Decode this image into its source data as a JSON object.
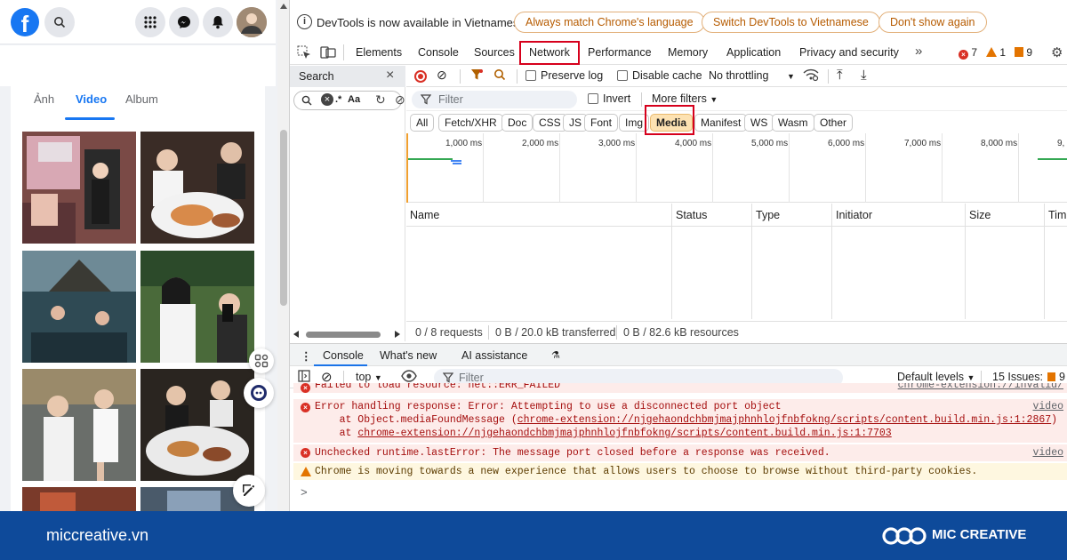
{
  "facebook": {
    "logo_letter": "f",
    "tabs": [
      "Ảnh",
      "Video",
      "Album"
    ],
    "active_tab": "Video",
    "colors": {
      "brand": "#1877f2"
    }
  },
  "devtools": {
    "infobar": {
      "message": "DevTools is now available in Vietnamese!",
      "buttons": [
        "Always match Chrome's language",
        "Switch DevTools to Vietnamese",
        "Don't show again"
      ]
    },
    "tabs": [
      "Elements",
      "Console",
      "Sources",
      "Network",
      "Performance",
      "Memory",
      "Application",
      "Privacy and security"
    ],
    "active_tab": "Network",
    "counts": {
      "errors": "7",
      "warnings": "1",
      "issues": "9"
    },
    "sidebar": {
      "title": "Search",
      "search_opts": ".*",
      "search_case": "Aa"
    },
    "network_toolbar": {
      "preserve_log": "Preserve log",
      "disable_cache": "Disable cache",
      "throttling": "No throttling"
    },
    "filter": {
      "placeholder": "Filter",
      "invert": "Invert",
      "more_filters": "More filters"
    },
    "type_filters": [
      "All",
      "Fetch/XHR",
      "Doc",
      "CSS",
      "JS",
      "Font",
      "Img",
      "Media",
      "Manifest",
      "WS",
      "Wasm",
      "Other"
    ],
    "active_type": "Media",
    "timeline_labels": [
      "1,000 ms",
      "2,000 ms",
      "3,000 ms",
      "4,000 ms",
      "5,000 ms",
      "6,000 ms",
      "7,000 ms",
      "8,000 ms",
      "9,"
    ],
    "columns": [
      "Name",
      "Status",
      "Type",
      "Initiator",
      "Size",
      "Tim"
    ],
    "status_bar": {
      "requests": "0 / 8 requests",
      "transferred": "0 B / 20.0 kB transferred",
      "resources": "0 B / 82.6 kB resources"
    },
    "drawer_tabs": [
      "Console",
      "What's new",
      "AI assistance"
    ],
    "console_toolbar": {
      "context": "top",
      "filter_placeholder": "Filter",
      "levels": "Default levels",
      "issues_label": "15 Issues:",
      "issues_count": "9"
    },
    "console_messages": {
      "partial_top": "Failed to load resource: net::ERR_FAILED",
      "partial_top_src": "chrome-extension://invalid/",
      "err1_line1": "Error handling response: Error: Attempting to use a disconnected port object",
      "err1_line2_prefix": "    at Object.mediaFoundMessage (",
      "err1_line2_link": "chrome-extension://njgehaondchbmjmajphnhlojfnbfokng/scripts/content.build.min.js:1:2867",
      "err1_line2_suffix": ")",
      "err1_line3_prefix": "    at ",
      "err1_line3_link": "chrome-extension://njgehaondchbmjmajphnhlojfnbfokng/scripts/content.build.min.js:1:7703",
      "err1_src": "video",
      "err2": "Unchecked runtime.lastError: The message port closed before a response was received.",
      "err2_src": "video",
      "warn1": "Chrome is moving towards a new experience that allows users to choose to browse without third-party cookies.",
      "prompt": ">"
    },
    "colors": {
      "highlight_box": "#d6001c",
      "media_chip": "#fde2b2",
      "error_bg": "#fdecea",
      "warning_bg": "#fef7e0"
    }
  },
  "footer": {
    "url": "miccreative.vn",
    "brand": "MIC CREATIVE",
    "background": "#0e4a9a"
  }
}
